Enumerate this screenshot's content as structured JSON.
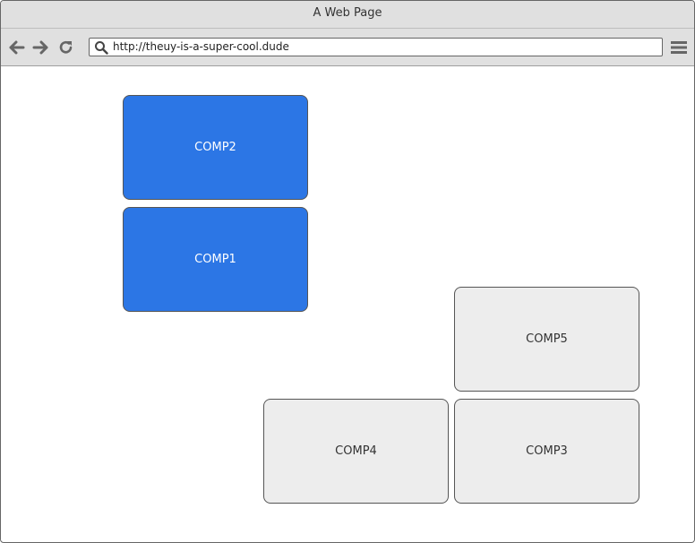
{
  "window": {
    "title": "A Web Page"
  },
  "toolbar": {
    "url": "http://theuy-is-a-super-cool.dude",
    "back_icon": "arrow-left-icon",
    "forward_icon": "arrow-right-icon",
    "reload_icon": "reload-icon",
    "search_icon": "search-icon",
    "menu_icon": "hamburger-menu-icon"
  },
  "components": {
    "comp2": "COMP2",
    "comp1": "COMP1",
    "comp5": "COMP5",
    "comp4": "COMP4",
    "comp3": "COMP3"
  },
  "colors": {
    "primary_blue": "#2c76e5",
    "gray_fill": "#ededed",
    "chrome": "#e0e0e0"
  }
}
